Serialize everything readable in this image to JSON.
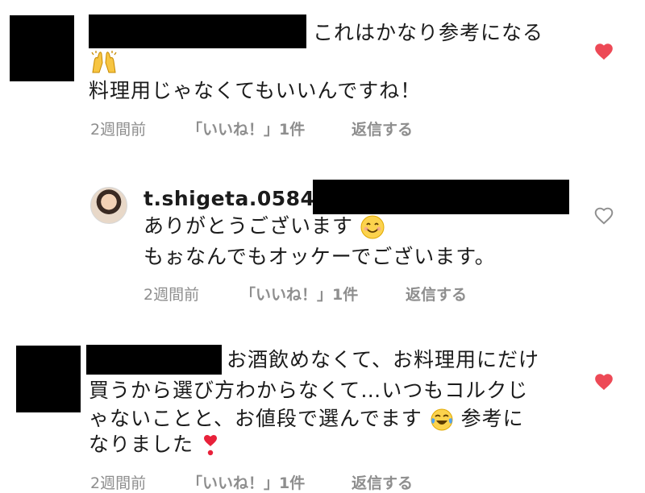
{
  "comments": [
    {
      "text_line1": "これはかなり参考になる",
      "text_line2": "料理用じゃなくてもいいんですね！",
      "time": "2週間前",
      "likes": "「いいね！」1件",
      "reply": "返信する",
      "liked": true,
      "emoji_icon": "raising-hands-icon"
    },
    {
      "username": "t.shigeta.0584",
      "text_line1": "ありがとうございます",
      "text_line2": "もぉなんでもオッケーでございます。",
      "time": "2週間前",
      "likes": "「いいね！」1件",
      "reply": "返信する",
      "liked": false,
      "emoji_icon": "smiling-face-icon"
    },
    {
      "text_line1": "お酒飲めなくて、お料理用にだけ",
      "text_line2": "買うから選び方わからなくて…いつもコルクじ",
      "text_line3a": "ゃないことと、お値段で選んでます",
      "text_line3b": "参考に",
      "text_line4": "なりました",
      "time": "2週間前",
      "likes": "「いいね！」1件",
      "reply": "返信する",
      "liked": true,
      "emoji_icon_1": "tears-of-joy-icon",
      "emoji_icon_2": "heart-exclamation-icon"
    }
  ],
  "colors": {
    "heart_active": "#ed4956",
    "heart_inactive": "#8e8e8e",
    "meta_text": "#8e8e8e"
  }
}
